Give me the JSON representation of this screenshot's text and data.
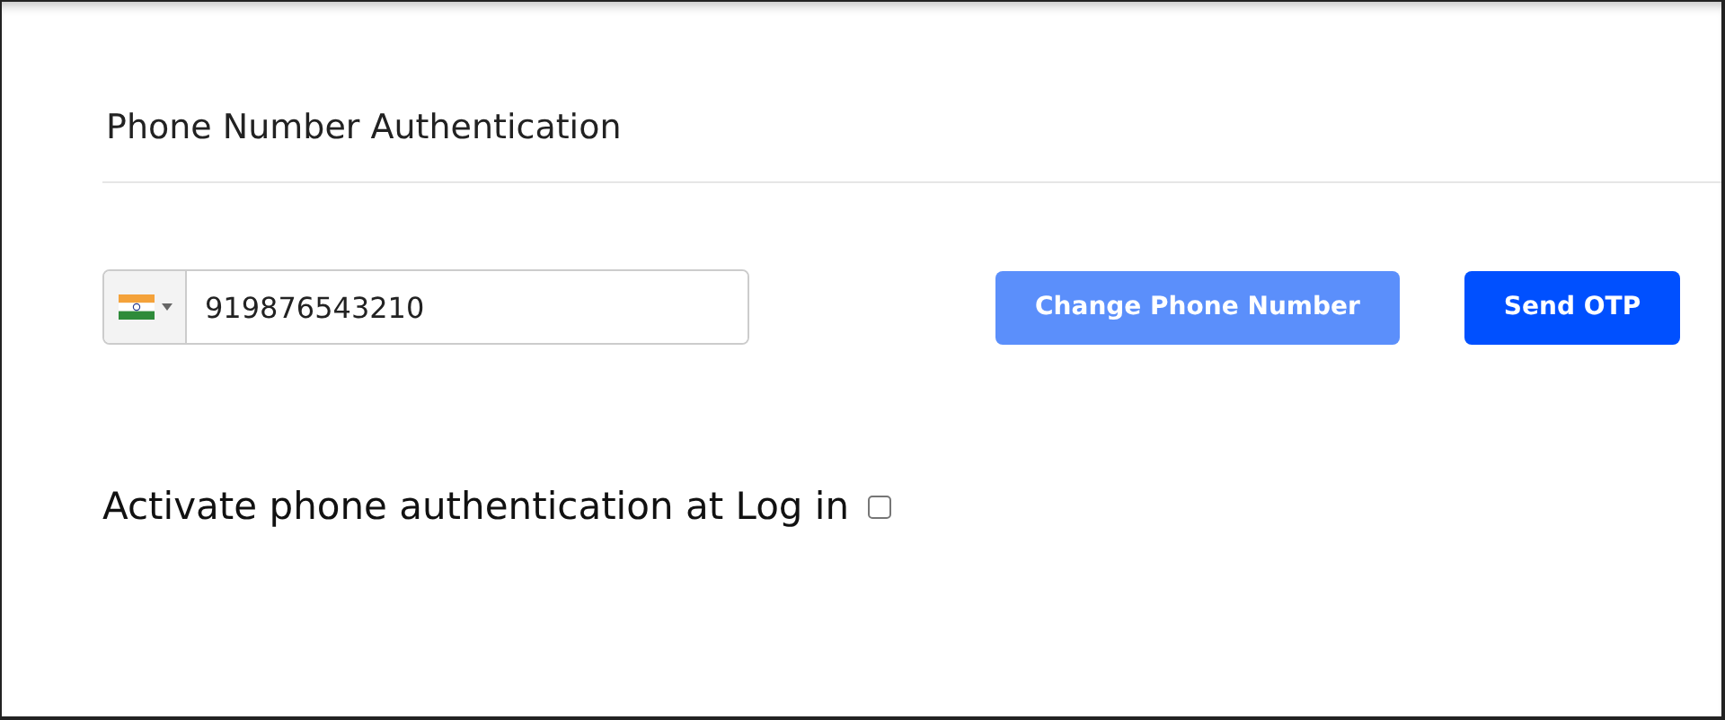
{
  "title": "Phone Number Authentication",
  "phone": {
    "value": "919876543210"
  },
  "buttons": [
    {
      "label": "Change Phone Number",
      "kind": "secondary",
      "disabled": true
    },
    {
      "label": "Send OTP",
      "kind": "primary",
      "disabled": false
    }
  ],
  "activation": {
    "label": "Activate phone authentication at Log in",
    "checked": false
  }
}
